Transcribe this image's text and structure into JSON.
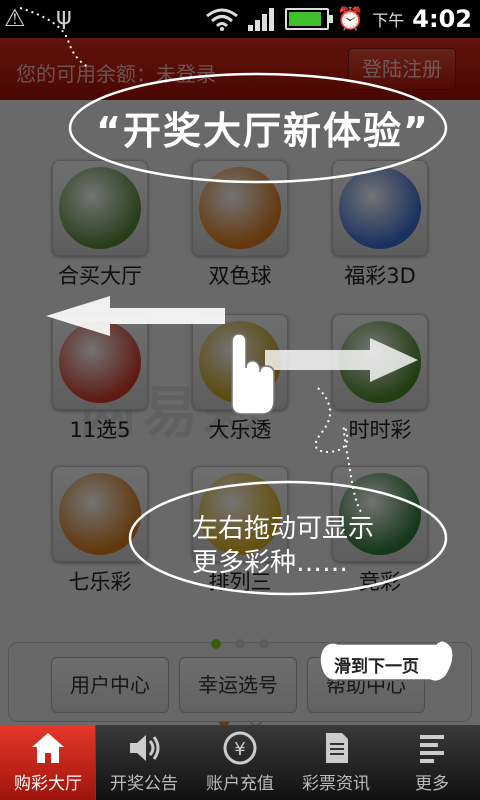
{
  "status_bar": {
    "ampm": "下午",
    "time": "4:02",
    "battery_level": 0.9
  },
  "header": {
    "balance_text": "您的可用余额：未登录",
    "login_label": "登陆注册"
  },
  "watermark": "网易彩",
  "lottery_grid": [
    {
      "label": "合买大厅",
      "icon": "group-buy-icon",
      "color": "#5a8a3c"
    },
    {
      "label": "双色球",
      "icon": "union-lotto-icon",
      "color": "#e07a1c"
    },
    {
      "label": "福彩3D",
      "icon": "fucai-3d-icon",
      "color": "#3b6fd6"
    },
    {
      "label": "11选5",
      "icon": "eleven-pick-five-icon",
      "color": "#d23c2a"
    },
    {
      "label": "大乐透",
      "icon": "super-lotto-icon",
      "color": "#c8a11a"
    },
    {
      "label": "时时彩",
      "icon": "shishicai-icon",
      "color": "#4c8a2a"
    },
    {
      "label": "七乐彩",
      "icon": "qilecai-icon",
      "color": "#d97a1a"
    },
    {
      "label": "排列三",
      "icon": "pailie-three-icon",
      "color": "#e0b01c"
    },
    {
      "label": "竞彩",
      "icon": "jingcai-soccer-icon",
      "color": "#2f7b3a"
    }
  ],
  "pager": {
    "page_count": 2,
    "current_page": 1
  },
  "bottom_buttons": [
    {
      "label": "用户中心"
    },
    {
      "label": "幸运选号"
    },
    {
      "label": "帮助中心"
    }
  ],
  "bottom_pager": {
    "active_dot": 1,
    "dot_count": 3
  },
  "tabs": [
    {
      "label": "购彩大厅",
      "icon": "home-icon",
      "active": true
    },
    {
      "label": "开奖公告",
      "icon": "speaker-icon",
      "active": false
    },
    {
      "label": "账户充值",
      "icon": "yuan-coin-icon",
      "active": false
    },
    {
      "label": "彩票资讯",
      "icon": "document-icon",
      "active": false
    },
    {
      "label": "更多",
      "icon": "more-list-icon",
      "active": false
    }
  ],
  "guide": {
    "headline": "“开奖大厅新体验”",
    "swipe_hint_line1": "左右拖动可显示",
    "swipe_hint_line2": "更多彩种……",
    "next_page_label": "滑到下一页"
  },
  "colors": {
    "accent_red": "#c8190d",
    "orange_dot": "#e87a2c",
    "green_dot": "#7ed321"
  }
}
